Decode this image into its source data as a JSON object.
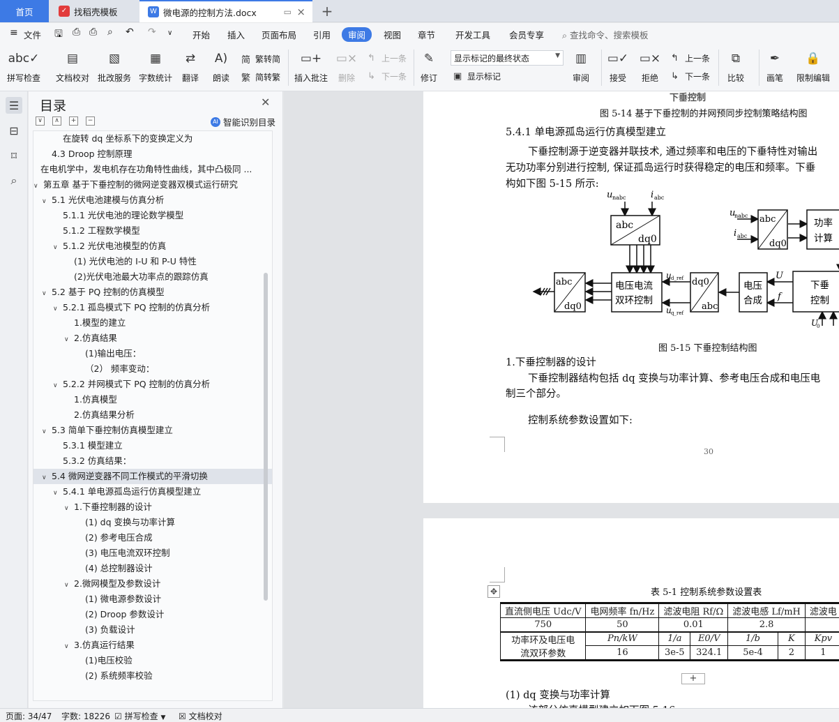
{
  "tabs": {
    "home": "首页",
    "template": "找稻壳模板",
    "doc": "微电源的控制方法.docx"
  },
  "menu": {
    "file": "文件",
    "items": [
      "开始",
      "插入",
      "页面布局",
      "引用",
      "审阅",
      "视图",
      "章节",
      "开发工具",
      "会员专享"
    ],
    "active": "审阅",
    "search": "查找命令、搜索模板"
  },
  "ribbon": {
    "spell": "拼写检查",
    "proof": "文档校对",
    "batch": "批改服务",
    "wordcount": "字数统计",
    "translate": "翻译",
    "read": "朗读",
    "trad": "繁转简",
    "simp": "简转繁",
    "insert_comment": "插入批注",
    "delete": "删除",
    "prev": "上一条",
    "next": "下一条",
    "track": "修订",
    "markup_mode": "显示标记的最终状态",
    "show_markup": "显示标记",
    "review": "审阅",
    "accept": "接受",
    "reject": "拒绝",
    "prev2": "上一条",
    "next2": "下一条",
    "compare": "比较",
    "pen": "画笔",
    "restrict": "限制编辑"
  },
  "toc": {
    "title": "目录",
    "smart": "智能识别目录",
    "items": [
      {
        "text": "在旋转 dq 坐标系下的变换定义为",
        "level": 3,
        "caret": ""
      },
      {
        "text": "4.3 Droop 控制原理",
        "level": 2,
        "caret": ""
      },
      {
        "text": "在电机学中，发电机存在功角特性曲线，其中凸极同 ...",
        "level": 1,
        "caret": ""
      },
      {
        "text": "第五章  基于下垂控制的微网逆变器双模式运行研究",
        "level": 1,
        "caret": "v"
      },
      {
        "text": "5.1  光伏电池建模与仿真分析",
        "level": 2,
        "caret": "v"
      },
      {
        "text": "5.1.1  光伏电池的理论数学模型",
        "level": 3,
        "caret": ""
      },
      {
        "text": "5.1.2  工程数学模型",
        "level": 3,
        "caret": ""
      },
      {
        "text": "5.1.2 光伏电池模型的仿真",
        "level": 3,
        "caret": "v"
      },
      {
        "text": "(1) 光伏电池的 I-U 和 P-U 特性",
        "level": 4,
        "caret": ""
      },
      {
        "text": "(2)光伏电池最大功率点的跟踪仿真",
        "level": 4,
        "caret": ""
      },
      {
        "text": "5.2  基于 PQ 控制的仿真模型",
        "level": 2,
        "caret": "v"
      },
      {
        "text": "5.2.1  孤岛模式下 PQ 控制的仿真分析",
        "level": 3,
        "caret": "v"
      },
      {
        "text": "1.模型的建立",
        "level": 4,
        "caret": ""
      },
      {
        "text": "2.仿真结果",
        "level": 4,
        "caret": "v"
      },
      {
        "text": "(1)输出电压：",
        "level": 5,
        "caret": ""
      },
      {
        "text": "（2）  频率变动：",
        "level": 5,
        "caret": ""
      },
      {
        "text": "5.2.2  并网模式下 PQ 控制的仿真分析",
        "level": 3,
        "caret": "v"
      },
      {
        "text": "1.仿真模型",
        "level": 4,
        "caret": ""
      },
      {
        "text": "2.仿真结果分析",
        "level": 4,
        "caret": ""
      },
      {
        "text": "5.3  简单下垂控制仿真模型建立",
        "level": 2,
        "caret": "v"
      },
      {
        "text": "5.3.1  模型建立",
        "level": 3,
        "caret": ""
      },
      {
        "text": "5.3.2  仿真结果：",
        "level": 3,
        "caret": ""
      },
      {
        "text": "5.4  微网逆变器不同工作模式的平滑切换",
        "level": 2,
        "caret": "v",
        "selected": true
      },
      {
        "text": "5.4.1  单电源孤岛运行仿真模型建立",
        "level": 3,
        "caret": "v"
      },
      {
        "text": "1.下垂控制器的设计",
        "level": 4,
        "caret": "v"
      },
      {
        "text": "(1) dq 变换与功率计算",
        "level": 5,
        "caret": ""
      },
      {
        "text": "(2)  参考电压合成",
        "level": 5,
        "caret": ""
      },
      {
        "text": "(3)  电压电流双环控制",
        "level": 5,
        "caret": ""
      },
      {
        "text": "(4)  总控制器设计",
        "level": 5,
        "caret": ""
      },
      {
        "text": "2.微网模型及参数设计",
        "level": 4,
        "caret": "v"
      },
      {
        "text": "(1)  微电源参数设计",
        "level": 5,
        "caret": ""
      },
      {
        "text": "(2) Droop 参数设计",
        "level": 5,
        "caret": ""
      },
      {
        "text": "(3)  负载设计",
        "level": 5,
        "caret": ""
      },
      {
        "text": "3.仿真运行结果",
        "level": 4,
        "caret": "v"
      },
      {
        "text": "(1)电压校验",
        "level": 5,
        "caret": ""
      },
      {
        "text": "(2)  系统频率校验",
        "level": 5,
        "caret": ""
      }
    ]
  },
  "page1": {
    "fig_top_label": "下垂控制",
    "caption_514": "图 5-14  基于下垂控制的并网预同步控制策略结构图",
    "heading": "5.4.1  单电源孤岛运行仿真模型建立",
    "para1_l1": "下垂控制源于逆变器并联技术, 通过频率和电压的下垂特性对输出",
    "para1_l2": "无功功率分别进行控制, 保证孤岛运行时获得稳定的电压和频率。下垂",
    "para1_l3": "构如下图 5-15 所示:",
    "diagram": {
      "abc_dq0_top_a": "abc",
      "abc_dq0_top_b": "dq0",
      "u_nabc": "u",
      "u_sub": "nabc",
      "i_abc": "i",
      "i_sub": "abc",
      "vc_l1": "电压电流",
      "vc_l2": "双环控制",
      "dq0_abc_a": "dq0",
      "dq0_abc_b": "abc",
      "synth_l1": "电压",
      "synth_l2": "合成",
      "power_l1": "功率",
      "power_l2": "计算",
      "droop_l1": "下垂",
      "droop_l2": "控制",
      "ud_ref": "u",
      "ud_sub": "d_ref",
      "uq_ref": "u",
      "uq_sub": "q_ref",
      "U": "U",
      "f": "f",
      "U0": "U",
      "U0_sub": "0"
    },
    "caption_515": "图 5-15  下垂控制结构图",
    "sub1": "1.下垂控制器的设计",
    "para2_l1": "下垂控制器结构包括 dq 变换与功率计算、参考电压合成和电压电",
    "para2_l2": "制三个部分。",
    "para3": "控制系统参数设置如下:",
    "page_no": "30"
  },
  "page2": {
    "table_caption": "表 5-1  控制系统参数设置表",
    "table_header": [
      "直流侧电压 Udc/V",
      "电网频率 fn/Hz",
      "滤波电阻 Rf/Ω",
      "滤波电感 Lf/mH",
      "滤波电"
    ],
    "table_row1": [
      "750",
      "50",
      "0.01",
      "2.8",
      ""
    ],
    "table_group_l1": "功率环及电压电",
    "table_group_l2": "流双环参数",
    "table_sub_header": [
      "Pn/kW",
      "1/a",
      "E0/V",
      "1/b",
      "K",
      "Kpv"
    ],
    "table_sub_values": [
      "16",
      "3e-5",
      "324.1",
      "5e-4",
      "2",
      "1"
    ],
    "sub2": "(1) dq 变换与功率计算",
    "para4": "该部分仿真模型建立如下图 5-16:"
  },
  "status": {
    "page": "页面: 34/47",
    "words": "字数: 18226",
    "spell": "拼写检查",
    "proof": "文档校对"
  }
}
